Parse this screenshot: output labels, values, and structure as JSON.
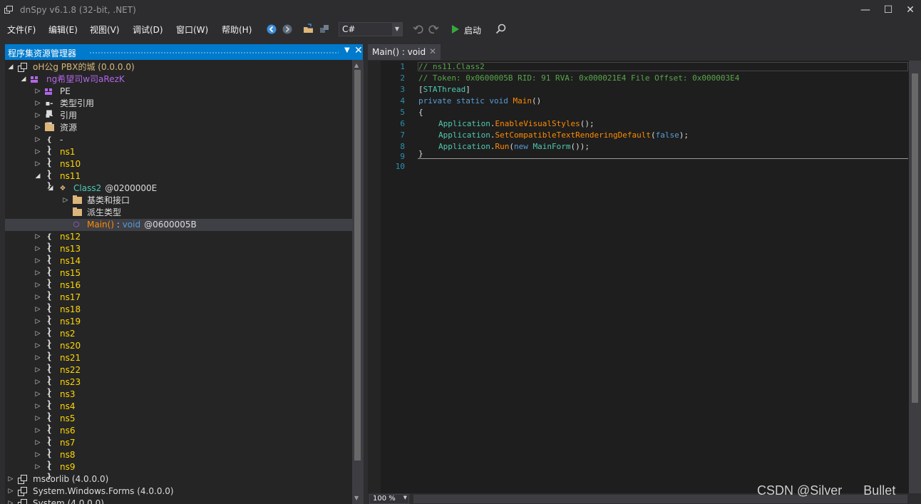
{
  "window": {
    "title": "dnSpy v6.1.8 (32-bit, .NET)",
    "minimize": "—",
    "maximize": "☐",
    "close": "✕"
  },
  "menu": [
    "文件(F)",
    "编辑(E)",
    "视图(V)",
    "调试(D)",
    "窗口(W)",
    "帮助(H)"
  ],
  "toolbar": {
    "language": "C#",
    "start_label": "启动"
  },
  "explorer": {
    "title": "程序集资源管理器",
    "items": [
      {
        "label": "oH公g PBX的城 (0.0.0.0)",
        "icon": "assembly-icon"
      },
      {
        "label": "ng希望司w司aRezK",
        "icon": "module-icon"
      },
      {
        "label": "PE",
        "icon": "pe-icon"
      },
      {
        "label": "类型引用",
        "icon": "type-refs-icon"
      },
      {
        "label": "引用",
        "icon": "refs-icon"
      },
      {
        "label": "资源",
        "icon": "folder-icon"
      },
      {
        "label": "-",
        "icon": "namespace-icon"
      },
      {
        "label": "ns1",
        "icon": "namespace-icon"
      },
      {
        "label": "ns10",
        "icon": "namespace-icon"
      },
      {
        "label": "ns11",
        "icon": "namespace-icon"
      },
      {
        "label": "Class2",
        "token": "@0200000E",
        "icon": "class-icon"
      },
      {
        "label": "基类和接口",
        "icon": "folder-icon"
      },
      {
        "label": "派生类型",
        "icon": "folder-icon"
      },
      {
        "label": "Main()",
        "sep": " : ",
        "type": "void",
        "token": "@0600005B",
        "icon": "method-icon"
      },
      {
        "label": "ns12",
        "icon": "namespace-icon"
      },
      {
        "label": "ns13",
        "icon": "namespace-icon"
      },
      {
        "label": "ns14",
        "icon": "namespace-icon"
      },
      {
        "label": "ns15",
        "icon": "namespace-icon"
      },
      {
        "label": "ns16",
        "icon": "namespace-icon"
      },
      {
        "label": "ns17",
        "icon": "namespace-icon"
      },
      {
        "label": "ns18",
        "icon": "namespace-icon"
      },
      {
        "label": "ns19",
        "icon": "namespace-icon"
      },
      {
        "label": "ns2",
        "icon": "namespace-icon"
      },
      {
        "label": "ns20",
        "icon": "namespace-icon"
      },
      {
        "label": "ns21",
        "icon": "namespace-icon"
      },
      {
        "label": "ns22",
        "icon": "namespace-icon"
      },
      {
        "label": "ns23",
        "icon": "namespace-icon"
      },
      {
        "label": "ns3",
        "icon": "namespace-icon"
      },
      {
        "label": "ns4",
        "icon": "namespace-icon"
      },
      {
        "label": "ns5",
        "icon": "namespace-icon"
      },
      {
        "label": "ns6",
        "icon": "namespace-icon"
      },
      {
        "label": "ns7",
        "icon": "namespace-icon"
      },
      {
        "label": "ns8",
        "icon": "namespace-icon"
      },
      {
        "label": "ns9",
        "icon": "namespace-icon"
      },
      {
        "label": "mscorlib (4.0.0.0)",
        "icon": "assembly-icon"
      },
      {
        "label": "System.Windows.Forms (4.0.0.0)",
        "icon": "assembly-icon"
      },
      {
        "label": "System (4.0.0.0)",
        "icon": "assembly-icon"
      }
    ]
  },
  "editor": {
    "tab": "Main() : void",
    "zoom": "100 %",
    "line_numbers": [
      "1",
      "2",
      "3",
      "4",
      "5",
      "6",
      "7",
      "8",
      "9",
      "10"
    ],
    "code": {
      "l1": "// ns11.Class2",
      "l2": "// Token: 0x0600005B RID: 91 RVA: 0x000021E4 File Offset: 0x000003E4",
      "l3_open": "[",
      "l3_attr": "STAThread",
      "l3_close": "]",
      "l4_kw": "private static void",
      "l4_name": "Main",
      "l4_rest": "()",
      "l5": "{",
      "l6_type": "Application",
      "l6_dot": ".",
      "l6_method": "EnableVisualStyles",
      "l6_rest": "();",
      "l7_type": "Application",
      "l7_dot": ".",
      "l7_method": "SetCompatibleTextRenderingDefault",
      "l7_open": "(",
      "l7_kw": "false",
      "l7_rest": ");",
      "l8_type": "Application",
      "l8_dot": ".",
      "l8_method": "Run",
      "l8_open": "(",
      "l8_kw": "new",
      "l8_sp": " ",
      "l8_type2": "MainForm",
      "l8_rest": "());",
      "l9": "}"
    }
  },
  "watermark": "CSDN @Silver      Bullet",
  "colors": {
    "accent": "#007acc",
    "namespace": "#ffd700",
    "class": "#4ec9b0",
    "method": "#ff8c00",
    "keyword": "#569cd6",
    "comment": "#57a64a"
  }
}
